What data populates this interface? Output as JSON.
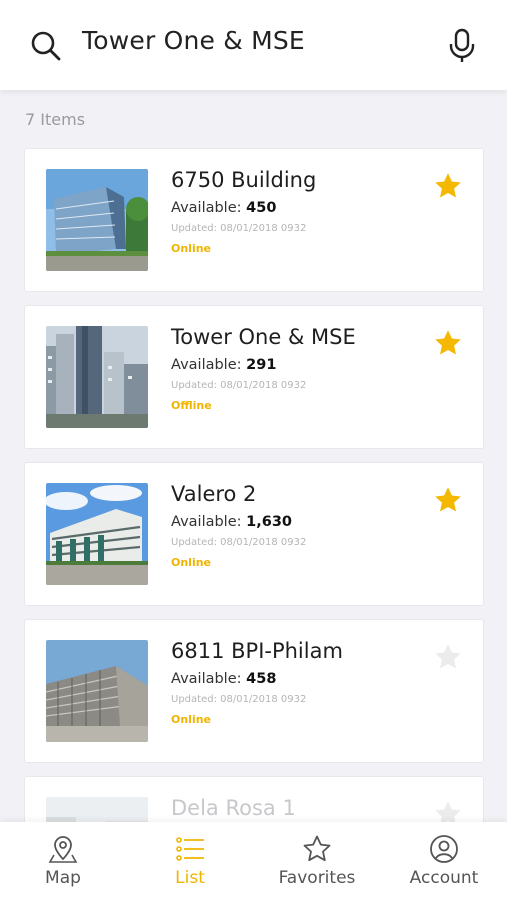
{
  "search": {
    "query": "Tower One & MSE"
  },
  "list": {
    "count_label": "7 Items",
    "items": [
      {
        "name": "6750 Building",
        "available_label": "Available:",
        "available": "450",
        "updated": "Updated: 08/01/2018 0932",
        "status": "Online",
        "favorite": true
      },
      {
        "name": "Tower One & MSE",
        "available_label": "Available:",
        "available": "291",
        "updated": "Updated: 08/01/2018 0932",
        "status": "Offline",
        "favorite": true
      },
      {
        "name": "Valero 2",
        "available_label": "Available:",
        "available": "1,630",
        "updated": "Updated: 08/01/2018 0932",
        "status": "Online",
        "favorite": true
      },
      {
        "name": "6811 BPI-Philam",
        "available_label": "Available:",
        "available": "458",
        "updated": "Updated: 08/01/2018 0932",
        "status": "Online",
        "favorite": false
      },
      {
        "name": "Dela Rosa 1",
        "favorite": false
      }
    ]
  },
  "tabs": [
    {
      "label": "Map",
      "icon": "map-pin-icon",
      "active": false
    },
    {
      "label": "List",
      "icon": "list-icon",
      "active": true
    },
    {
      "label": "Favorites",
      "icon": "star-outline-icon",
      "active": false
    },
    {
      "label": "Account",
      "icon": "user-circle-icon",
      "active": false
    }
  ],
  "colors": {
    "accent": "#f0b400",
    "star_active": "#f5b800",
    "star_inactive": "#ececec",
    "background": "#f2f2f6"
  }
}
